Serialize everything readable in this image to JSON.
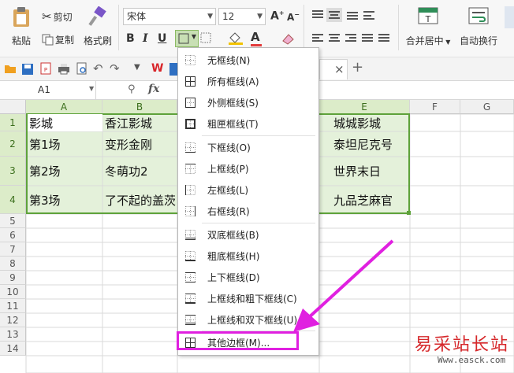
{
  "ribbon": {
    "paste": "粘贴",
    "cut": "剪切",
    "copy": "复制",
    "format_painter": "格式刷",
    "font_name": "宋体",
    "font_size": "12",
    "merge_center": "合并居中",
    "wrap_text": "自动换行"
  },
  "formula_bar": {
    "name_box": "A1",
    "fx": "fx"
  },
  "tab": {
    "close": "×",
    "add": "+"
  },
  "columns": [
    "A",
    "B",
    "C",
    "D",
    "E",
    "F",
    "G"
  ],
  "rows": [
    "1",
    "2",
    "3",
    "4",
    "5",
    "6",
    "7",
    "8",
    "9",
    "10",
    "11",
    "12",
    "13",
    "14"
  ],
  "cells": {
    "a1": "影城",
    "b1": "香江影城",
    "e1": "城城影城",
    "a2": "第1场",
    "b2": "变形金刚",
    "e2": "泰坦尼克号",
    "a3": "第2场",
    "b3": "冬萌功2",
    "e3": "世界末日",
    "a4": "第3场",
    "b4": "了不起的盖茨",
    "e4": "九品芝麻官"
  },
  "menu": {
    "items": [
      {
        "label": "无框线(N)",
        "icon": "no-border-icon"
      },
      {
        "label": "所有框线(A)",
        "icon": "all-borders-icon"
      },
      {
        "label": "外侧框线(S)",
        "icon": "outside-borders-icon"
      },
      {
        "label": "粗匣框线(T)",
        "icon": "thick-box-border-icon"
      },
      {
        "label": "下框线(O)",
        "icon": "bottom-border-icon"
      },
      {
        "label": "上框线(P)",
        "icon": "top-border-icon"
      },
      {
        "label": "左框线(L)",
        "icon": "left-border-icon"
      },
      {
        "label": "右框线(R)",
        "icon": "right-border-icon"
      },
      {
        "label": "双底框线(B)",
        "icon": "double-bottom-border-icon"
      },
      {
        "label": "粗底框线(H)",
        "icon": "thick-bottom-border-icon"
      },
      {
        "label": "上下框线(D)",
        "icon": "top-bottom-border-icon"
      },
      {
        "label": "上框线和粗下框线(C)",
        "icon": "top-thick-bottom-border-icon"
      },
      {
        "label": "上框线和双下框线(U)",
        "icon": "top-double-bottom-border-icon"
      },
      {
        "label": "其他边框(M)...",
        "icon": "more-borders-icon"
      }
    ]
  },
  "watermark": {
    "title": "易采站长站",
    "url": "Www.easck.com"
  },
  "colors": {
    "accent_green": "#5ea23a",
    "selection_fill": "#e4f1da",
    "highlight": "#e020e0",
    "font_color_red": "#e23b3b"
  }
}
